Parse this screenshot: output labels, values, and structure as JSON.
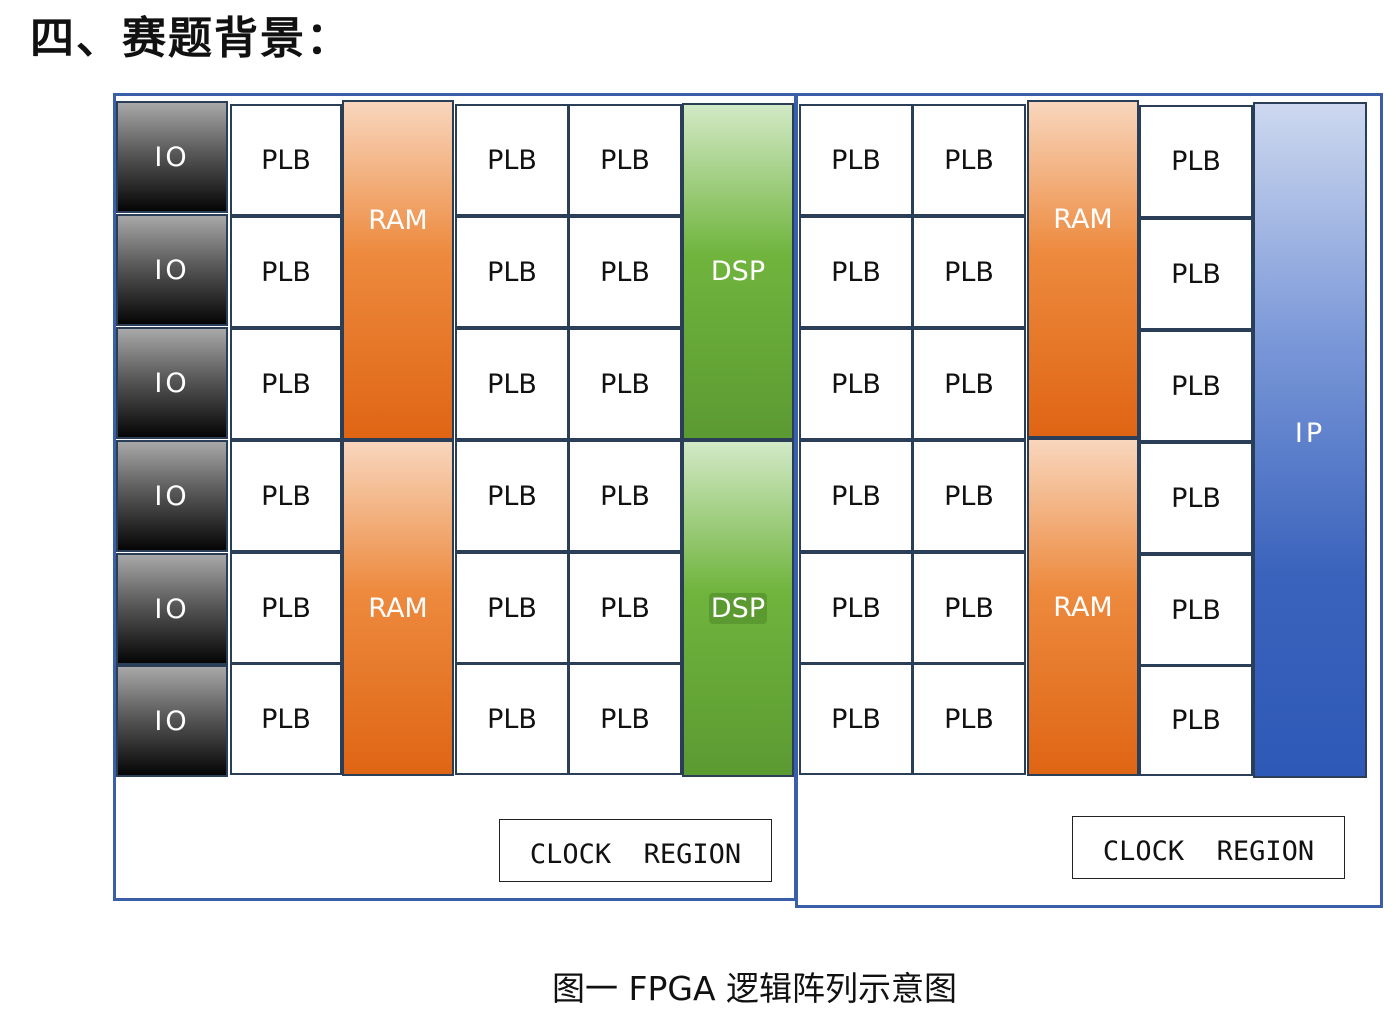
{
  "heading": "四、赛题背景：",
  "caption": "图一 FPGA 逻辑阵列示意图",
  "clock_left": "CLOCK  REGION",
  "clock_right": "CLOCK  REGION",
  "labels": {
    "io": "IO",
    "plb": "PLB",
    "ram": "RAM",
    "dsp": "DSP",
    "ip": "IP"
  },
  "colors": {
    "border": "#3a5fa8",
    "ram": "#e8782a",
    "dsp": "#6aae3b",
    "ip": "#3a63bc",
    "io": "#222222"
  }
}
